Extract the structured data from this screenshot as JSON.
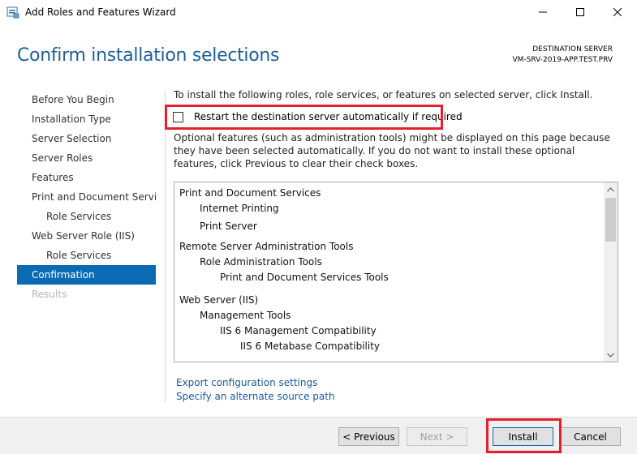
{
  "window": {
    "title": "Add Roles and Features Wizard"
  },
  "header": {
    "page_title": "Confirm installation selections",
    "destination_label": "DESTINATION SERVER",
    "destination_server": "VM-SRV-2019-APP.TEST.PRV"
  },
  "nav": {
    "items": [
      {
        "label": "Before You Begin",
        "level": 0,
        "state": "normal"
      },
      {
        "label": "Installation Type",
        "level": 0,
        "state": "normal"
      },
      {
        "label": "Server Selection",
        "level": 0,
        "state": "normal"
      },
      {
        "label": "Server Roles",
        "level": 0,
        "state": "normal"
      },
      {
        "label": "Features",
        "level": 0,
        "state": "normal"
      },
      {
        "label": "Print and Document Servi...",
        "level": 0,
        "state": "normal"
      },
      {
        "label": "Role Services",
        "level": 1,
        "state": "normal"
      },
      {
        "label": "Web Server Role (IIS)",
        "level": 0,
        "state": "normal"
      },
      {
        "label": "Role Services",
        "level": 1,
        "state": "normal"
      },
      {
        "label": "Confirmation",
        "level": 0,
        "state": "active"
      },
      {
        "label": "Results",
        "level": 0,
        "state": "disabled"
      }
    ]
  },
  "main": {
    "intro": "To install the following roles, role services, or features on selected server, click Install.",
    "restart_checkbox_label": "Restart the destination server automatically if required",
    "restart_checked": false,
    "optional_text": "Optional features (such as administration tools) might be displayed on this page because they have been selected automatically. If you do not want to install these optional features, click Previous to clear their check boxes.",
    "selections": [
      {
        "label": "Print and Document Services",
        "level": 0
      },
      {
        "label": "Internet Printing",
        "level": 1
      },
      {
        "label": "Print Server",
        "level": 1
      },
      {
        "label": "Remote Server Administration Tools",
        "level": 0
      },
      {
        "label": "Role Administration Tools",
        "level": 1
      },
      {
        "label": "Print and Document Services Tools",
        "level": 2
      },
      {
        "label": "Web Server (IIS)",
        "level": 0
      },
      {
        "label": "Management Tools",
        "level": 1
      },
      {
        "label": "IIS 6 Management Compatibility",
        "level": 2
      },
      {
        "label": "IIS 6 Metabase Compatibility",
        "level": 3
      }
    ],
    "export_link": "Export configuration settings",
    "source_link": "Specify an alternate source path"
  },
  "footer": {
    "previous_label": "< Previous",
    "next_label": "Next >",
    "install_label": "Install",
    "cancel_label": "Cancel"
  },
  "colors": {
    "accent": "#0a6ab3",
    "title_blue": "#1e5f9b",
    "highlight_red": "#e5202e",
    "link_blue": "#1a5aa0"
  }
}
